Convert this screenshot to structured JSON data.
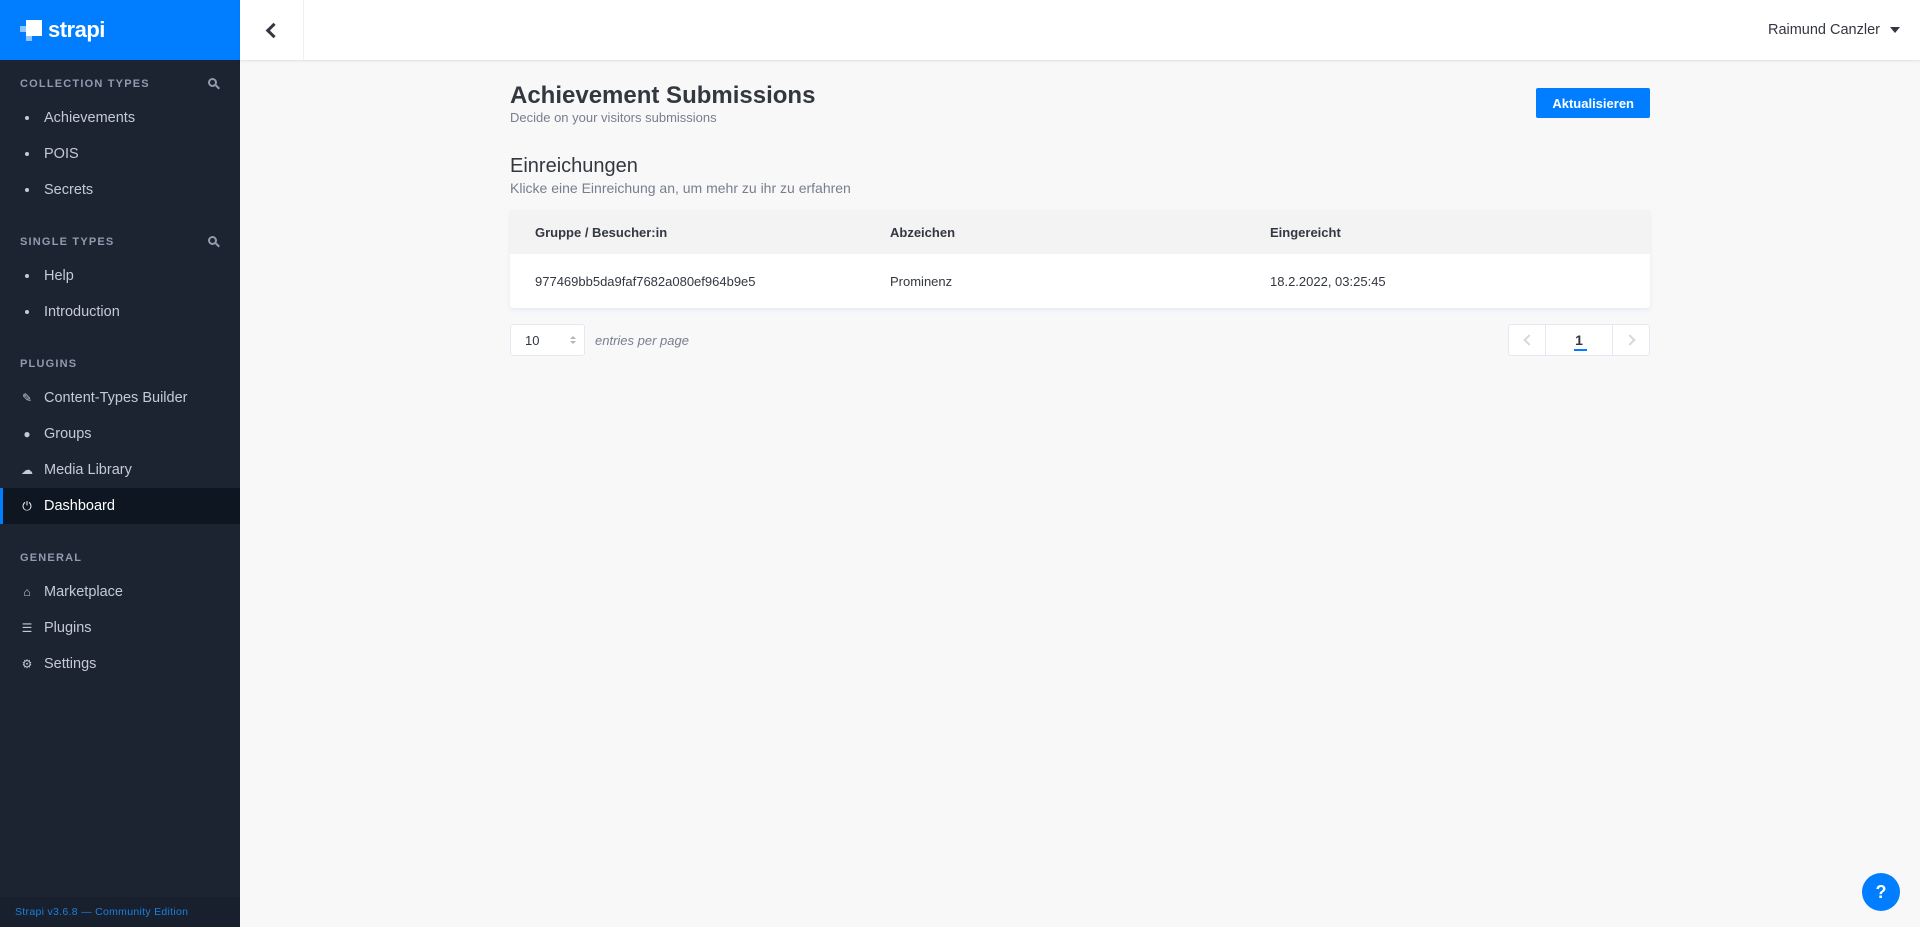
{
  "brand": {
    "name": "strapi",
    "accent": "#007eff"
  },
  "sidebar": {
    "collection_types": {
      "title": "Collection Types",
      "items": [
        {
          "label": "Achievements"
        },
        {
          "label": "POIS"
        },
        {
          "label": "Secrets"
        }
      ]
    },
    "single_types": {
      "title": "Single Types",
      "items": [
        {
          "label": "Help"
        },
        {
          "label": "Introduction"
        }
      ]
    },
    "plugins": {
      "title": "Plugins",
      "items": [
        {
          "label": "Content-Types Builder",
          "icon": "brush-icon"
        },
        {
          "label": "Groups",
          "icon": "users-icon"
        },
        {
          "label": "Media Library",
          "icon": "cloud-upload-icon"
        },
        {
          "label": "Dashboard",
          "icon": "plug-icon",
          "active": true
        }
      ]
    },
    "general": {
      "title": "General",
      "items": [
        {
          "label": "Marketplace",
          "icon": "shopping-basket-icon"
        },
        {
          "label": "Plugins",
          "icon": "list-icon"
        },
        {
          "label": "Settings",
          "icon": "gear-icon"
        }
      ]
    },
    "footer": "Strapi v3.6.8 — Community Edition"
  },
  "header": {
    "user_name": "Raimund Canzler"
  },
  "main": {
    "title": "Achievement Submissions",
    "subtitle": "Decide on your visitors submissions",
    "refresh_label": "Aktualisieren",
    "section_title": "Einreichungen",
    "section_subtitle": "Klicke eine Einreichung an, um mehr zu ihr zu erfahren",
    "table": {
      "columns": [
        "Gruppe / Besucher:in",
        "Abzeichen",
        "Eingereicht"
      ],
      "rows": [
        [
          "977469bb5da9faf7682a080ef964b9e5",
          "Prominenz",
          "18.2.2022, 03:25:45"
        ]
      ]
    },
    "entries_per_page": "10",
    "entries_per_page_label": "entries per page",
    "current_page": "1"
  },
  "help_label": "?"
}
